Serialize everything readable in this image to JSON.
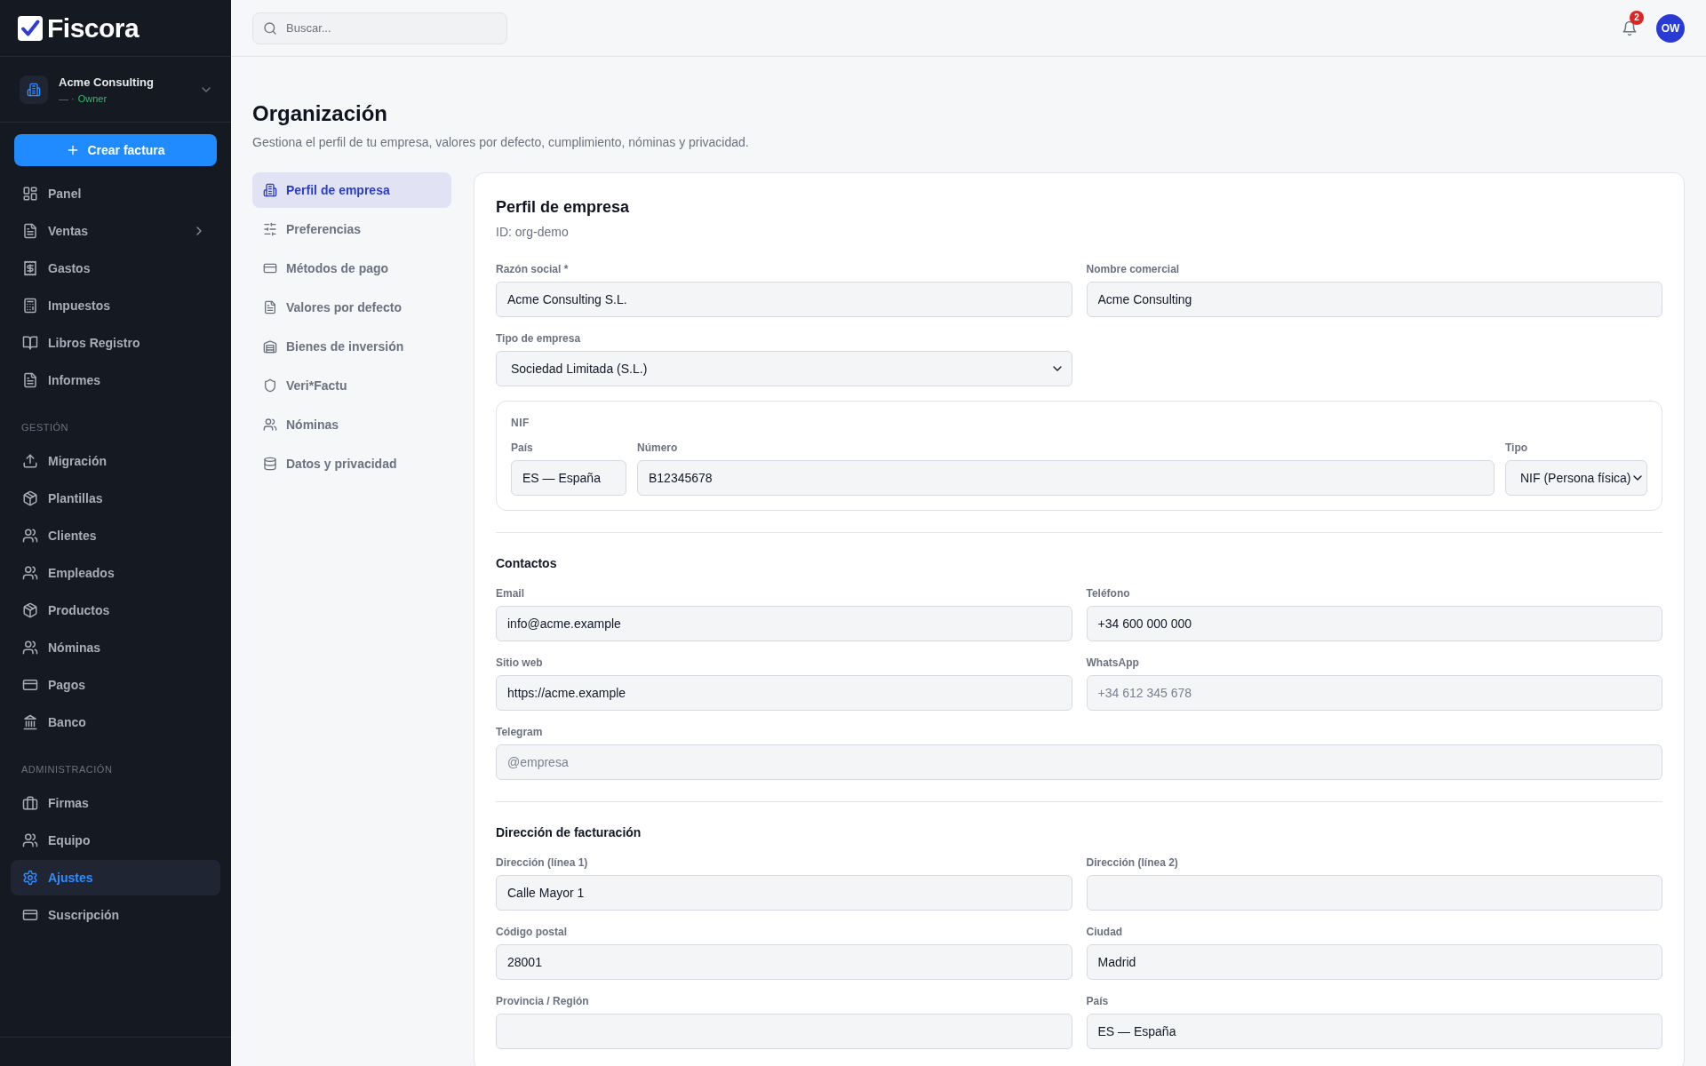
{
  "sidebar": {
    "logo": "Fiscora",
    "org": {
      "name": "Acme Consulting",
      "meta": "— ·",
      "role": "Owner"
    },
    "create_button": "Crear factura",
    "sections": [
      {
        "items": [
          {
            "label": "Panel",
            "selected": false,
            "expandable": false
          },
          {
            "label": "Ventas",
            "selected": false,
            "expandable": true
          },
          {
            "label": "Gastos",
            "selected": false,
            "expandable": false
          },
          {
            "label": "Impuestos",
            "selected": false,
            "expandable": false
          },
          {
            "label": "Libros Registro",
            "selected": false,
            "expandable": false
          },
          {
            "label": "Informes",
            "selected": false,
            "expandable": false
          }
        ]
      },
      {
        "heading": "GESTIÓN",
        "items": [
          {
            "label": "Migración",
            "selected": false,
            "expandable": false
          },
          {
            "label": "Plantillas",
            "selected": false,
            "expandable": false
          },
          {
            "label": "Clientes",
            "selected": false,
            "expandable": false
          },
          {
            "label": "Empleados",
            "selected": false,
            "expandable": false
          },
          {
            "label": "Productos",
            "selected": false,
            "expandable": false
          },
          {
            "label": "Nóminas",
            "selected": false,
            "expandable": false
          },
          {
            "label": "Pagos",
            "selected": false,
            "expandable": false
          },
          {
            "label": "Banco",
            "selected": false,
            "expandable": false
          }
        ]
      },
      {
        "heading": "ADMINISTRACIÓN",
        "items": [
          {
            "label": "Firmas",
            "selected": false,
            "expandable": false
          },
          {
            "label": "Equipo",
            "selected": false,
            "expandable": false
          },
          {
            "label": "Ajustes",
            "selected": true,
            "expandable": false
          },
          {
            "label": "Suscripción",
            "selected": false,
            "expandable": false
          }
        ]
      }
    ]
  },
  "topbar": {
    "search": {
      "placeholder": "Buscar..."
    },
    "notifications": "2",
    "avatar": "OW"
  },
  "page": {
    "title": "Organización",
    "subtitle": "Gestiona el perfil de tu empresa, valores por defecto, cumplimiento, nóminas y privacidad."
  },
  "settings_nav": [
    {
      "label": "Perfil de empresa",
      "selected": true
    },
    {
      "label": "Preferencias",
      "selected": false
    },
    {
      "label": "Métodos de pago",
      "selected": false
    },
    {
      "label": "Valores por defecto",
      "selected": false
    },
    {
      "label": "Bienes de inversión",
      "selected": false
    },
    {
      "label": "Veri*Factu",
      "selected": false
    },
    {
      "label": "Nóminas",
      "selected": false
    },
    {
      "label": "Datos y privacidad",
      "selected": false
    }
  ],
  "profile": {
    "title": "Perfil de empresa",
    "id_line": "ID: org-demo",
    "blocks": [
      {
        "kind": "row",
        "fields": [
          {
            "label": "Razón social *",
            "value": "Acme Consulting S.L.",
            "kind": "input",
            "wide": false
          },
          {
            "label": "Nombre comercial",
            "value": "Acme Consulting",
            "kind": "input",
            "wide": false
          }
        ]
      },
      {
        "kind": "row",
        "fields": [
          {
            "label": "Tipo de empresa",
            "value": "Sociedad Limitada (S.L.)",
            "kind": "select",
            "wide": false
          }
        ]
      },
      {
        "kind": "group",
        "legend": "NIF",
        "fields": [
          {
            "label": "País",
            "value": "ES — España",
            "kind": "input"
          },
          {
            "label": "Número",
            "value": "B12345678",
            "kind": "input"
          },
          {
            "label": "Tipo",
            "value": "NIF (Persona física)",
            "kind": "select"
          }
        ]
      },
      {
        "kind": "heading",
        "text": "Contactos"
      },
      {
        "kind": "row",
        "fields": [
          {
            "label": "Email",
            "value": "info@acme.example",
            "kind": "input",
            "wide": false
          },
          {
            "label": "Teléfono",
            "value": "+34 600 000 000",
            "kind": "input",
            "wide": false
          }
        ]
      },
      {
        "kind": "row",
        "fields": [
          {
            "label": "Sitio web",
            "value": "https://acme.example",
            "kind": "input",
            "wide": false
          },
          {
            "label": "WhatsApp",
            "placeholder": "+34 612 345 678",
            "kind": "input",
            "wide": false
          }
        ]
      },
      {
        "kind": "row",
        "fields": [
          {
            "label": "Telegram",
            "placeholder": "@empresa",
            "kind": "input",
            "wide": true
          }
        ]
      },
      {
        "kind": "heading",
        "text": "Dirección de facturación"
      },
      {
        "kind": "row",
        "fields": [
          {
            "label": "Dirección (línea 1)",
            "value": "Calle Mayor 1",
            "kind": "input",
            "wide": false
          },
          {
            "label": "Dirección (línea 2)",
            "kind": "input",
            "wide": false
          }
        ]
      },
      {
        "kind": "row",
        "fields": [
          {
            "label": "Código postal",
            "value": "28001",
            "kind": "input",
            "wide": false
          },
          {
            "label": "Ciudad",
            "value": "Madrid",
            "kind": "input",
            "wide": false
          }
        ]
      },
      {
        "kind": "row",
        "fields": [
          {
            "label": "Provincia / Región",
            "kind": "input",
            "wide": false
          },
          {
            "label": "País",
            "value": "ES — España",
            "kind": "input",
            "wide": false
          }
        ]
      }
    ]
  }
}
